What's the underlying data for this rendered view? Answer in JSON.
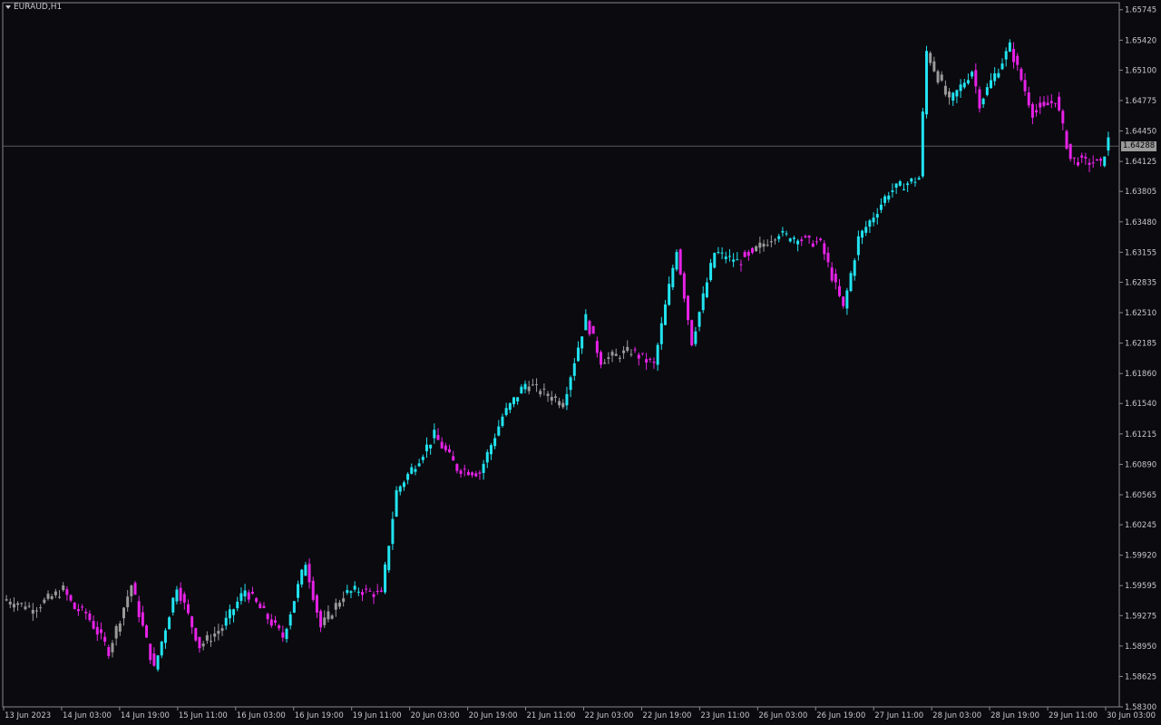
{
  "chart_data": {
    "type": "bar",
    "symbol": "EURAUD,H1",
    "current_price": "1.64288",
    "current_price_value": 1.64288,
    "ylim": [
      1.583,
      1.6582
    ],
    "y_ticks": [
      "1.65745",
      "1.65420",
      "1.65100",
      "1.64775",
      "1.64450",
      "1.64125",
      "1.63805",
      "1.63480",
      "1.63155",
      "1.62835",
      "1.62510",
      "1.62185",
      "1.61860",
      "1.61540",
      "1.61215",
      "1.60890",
      "1.60565",
      "1.60245",
      "1.59920",
      "1.59595",
      "1.59275",
      "1.58950",
      "1.58625",
      "1.58300"
    ],
    "x_ticks": [
      "13 Jun 2023",
      "14 Jun 03:00",
      "14 Jun 19:00",
      "15 Jun 11:00",
      "16 Jun 03:00",
      "16 Jun 19:00",
      "19 Jun 11:00",
      "20 Jun 03:00",
      "20 Jun 19:00",
      "21 Jun 11:00",
      "22 Jun 03:00",
      "22 Jun 19:00",
      "23 Jun 11:00",
      "26 Jun 03:00",
      "26 Jun 19:00",
      "27 Jun 11:00",
      "28 Jun 03:00",
      "28 Jun 19:00",
      "29 Jun 11:00",
      "30 Jun 03:00"
    ],
    "colors": {
      "background": "#0a0a0f",
      "bullish": "#22e3f0",
      "bearish": "#e622e6",
      "neutral": "#9a9a9a",
      "axis": "#8a8a8a",
      "text": "#c8c8c8",
      "price_line": "#5a5a5a"
    },
    "series_segments": [
      {
        "start": 1.5945,
        "end": 1.5935,
        "color": "neutral",
        "n": 8
      },
      {
        "start": 1.5935,
        "end": 1.5955,
        "color": "neutral",
        "n": 8
      },
      {
        "start": 1.5955,
        "end": 1.5935,
        "color": "bearish",
        "n": 3
      },
      {
        "start": 1.5935,
        "end": 1.593,
        "color": "bearish",
        "n": 3
      },
      {
        "start": 1.593,
        "end": 1.589,
        "color": "bearish",
        "n": 6
      },
      {
        "start": 1.589,
        "end": 1.596,
        "color": "neutral",
        "n": 6
      },
      {
        "start": 1.596,
        "end": 1.587,
        "color": "bearish",
        "n": 6
      },
      {
        "start": 1.587,
        "end": 1.596,
        "color": "bullish",
        "n": 6
      },
      {
        "start": 1.596,
        "end": 1.5895,
        "color": "bearish",
        "n": 6
      },
      {
        "start": 1.5895,
        "end": 1.5915,
        "color": "neutral",
        "n": 6
      },
      {
        "start": 1.5915,
        "end": 1.5955,
        "color": "bullish",
        "n": 6
      },
      {
        "start": 1.5955,
        "end": 1.5905,
        "color": "bearish",
        "n": 10
      },
      {
        "start": 1.5905,
        "end": 1.5985,
        "color": "bullish",
        "n": 6
      },
      {
        "start": 1.5985,
        "end": 1.5915,
        "color": "bearish",
        "n": 4
      },
      {
        "start": 1.5915,
        "end": 1.595,
        "color": "neutral",
        "n": 6
      },
      {
        "start": 1.595,
        "end": 1.5955,
        "color": "bullish",
        "n": 4
      },
      {
        "start": 1.5955,
        "end": 1.595,
        "color": "bearish",
        "n": 6
      },
      {
        "start": 1.595,
        "end": 1.606,
        "color": "bullish",
        "n": 4
      },
      {
        "start": 1.606,
        "end": 1.612,
        "color": "bullish",
        "n": 10
      },
      {
        "start": 1.612,
        "end": 1.6085,
        "color": "bearish",
        "n": 6
      },
      {
        "start": 1.6085,
        "end": 1.608,
        "color": "bearish",
        "n": 6
      },
      {
        "start": 1.608,
        "end": 1.614,
        "color": "bullish",
        "n": 6
      },
      {
        "start": 1.614,
        "end": 1.6175,
        "color": "bullish",
        "n": 6
      },
      {
        "start": 1.6175,
        "end": 1.6155,
        "color": "neutral",
        "n": 10
      },
      {
        "start": 1.6155,
        "end": 1.6245,
        "color": "bullish",
        "n": 6
      },
      {
        "start": 1.6245,
        "end": 1.62,
        "color": "bearish",
        "n": 4
      },
      {
        "start": 1.62,
        "end": 1.621,
        "color": "neutral",
        "n": 8
      },
      {
        "start": 1.621,
        "end": 1.6195,
        "color": "bearish",
        "n": 6
      },
      {
        "start": 1.6195,
        "end": 1.632,
        "color": "bullish",
        "n": 6
      },
      {
        "start": 1.632,
        "end": 1.622,
        "color": "bearish",
        "n": 4
      },
      {
        "start": 1.622,
        "end": 1.6315,
        "color": "bullish",
        "n": 6
      },
      {
        "start": 1.6315,
        "end": 1.6305,
        "color": "bullish",
        "n": 6
      },
      {
        "start": 1.6305,
        "end": 1.6315,
        "color": "bearish",
        "n": 4
      },
      {
        "start": 1.6315,
        "end": 1.6335,
        "color": "neutral",
        "n": 6
      },
      {
        "start": 1.6335,
        "end": 1.633,
        "color": "bullish",
        "n": 6
      },
      {
        "start": 1.633,
        "end": 1.6325,
        "color": "bearish",
        "n": 6
      },
      {
        "start": 1.6325,
        "end": 1.6255,
        "color": "bearish",
        "n": 6
      },
      {
        "start": 1.6255,
        "end": 1.633,
        "color": "bullish",
        "n": 4
      },
      {
        "start": 1.633,
        "end": 1.638,
        "color": "bullish",
        "n": 8
      },
      {
        "start": 1.638,
        "end": 1.6395,
        "color": "bullish",
        "n": 8
      },
      {
        "start": 1.6395,
        "end": 1.653,
        "color": "bullish",
        "n": 2
      },
      {
        "start": 1.653,
        "end": 1.6475,
        "color": "neutral",
        "n": 6
      },
      {
        "start": 1.6475,
        "end": 1.651,
        "color": "bullish",
        "n": 6
      },
      {
        "start": 1.651,
        "end": 1.6475,
        "color": "bearish",
        "n": 2
      },
      {
        "start": 1.6475,
        "end": 1.6535,
        "color": "bullish",
        "n": 8
      },
      {
        "start": 1.6535,
        "end": 1.6465,
        "color": "bearish",
        "n": 6
      },
      {
        "start": 1.6465,
        "end": 1.648,
        "color": "bearish",
        "n": 6
      },
      {
        "start": 1.648,
        "end": 1.6415,
        "color": "bearish",
        "n": 4
      },
      {
        "start": 1.6415,
        "end": 1.641,
        "color": "bearish",
        "n": 8
      },
      {
        "start": 1.641,
        "end": 1.6435,
        "color": "bullish",
        "n": 2
      }
    ]
  }
}
